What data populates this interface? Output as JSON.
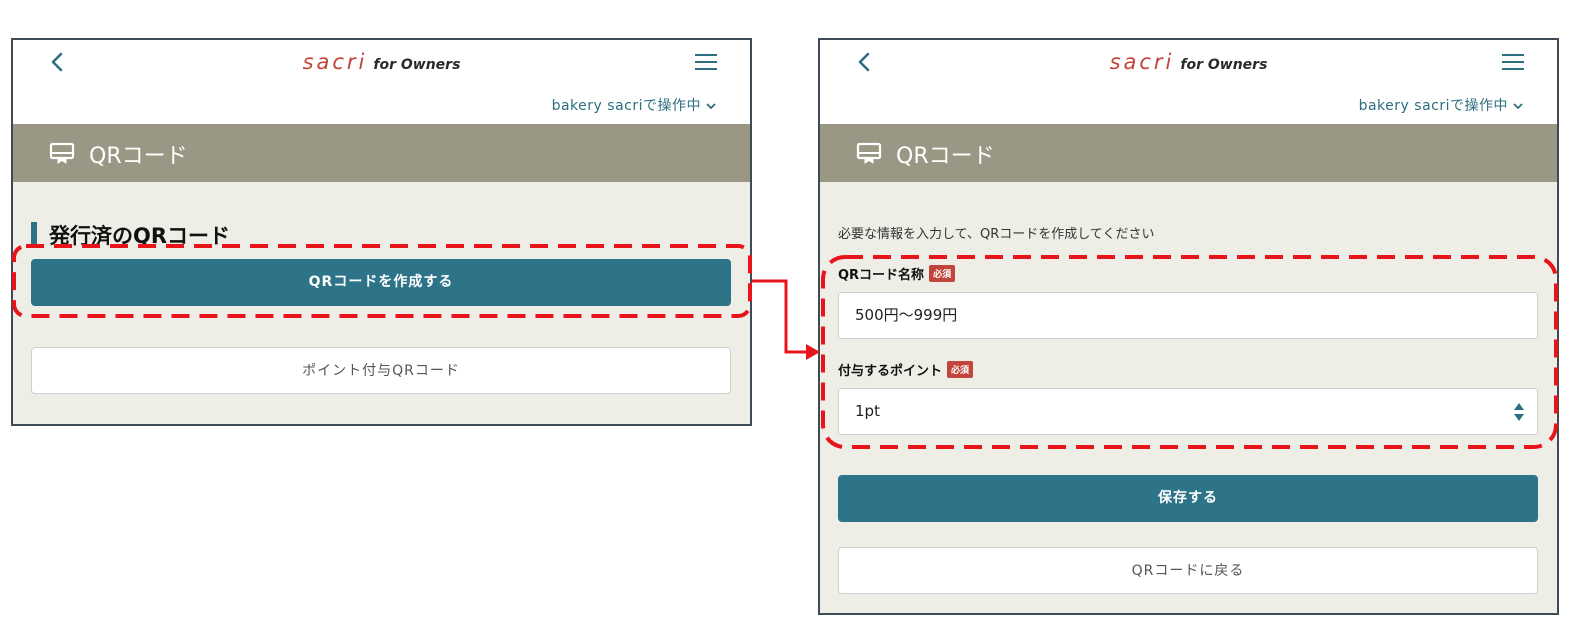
{
  "app": {
    "logo_main": "sacri",
    "logo_sub": "for Owners",
    "store_selector": "bakery sacriで操作中"
  },
  "left_screen": {
    "page_title": "QRコード",
    "section_title": "発行済のQRコード",
    "create_button": "QRコードを作成する",
    "point_qr_button": "ポイント付与QRコード"
  },
  "right_screen": {
    "page_title": "QRコード",
    "instruction": "必要な情報を入力して、QRコードを作成してください",
    "name_label": "QRコード名称",
    "required_badge": "必須",
    "name_value": "500円〜999円",
    "points_label": "付与するポイント",
    "points_value": "1pt",
    "save_button": "保存する",
    "back_button": "QRコードに戻る"
  },
  "colors": {
    "accent": "#2d7489",
    "logo_red": "#c1453b",
    "header_band": "#9a9884",
    "content_bg": "#efeee6",
    "annotation_red": "#e8141c"
  }
}
